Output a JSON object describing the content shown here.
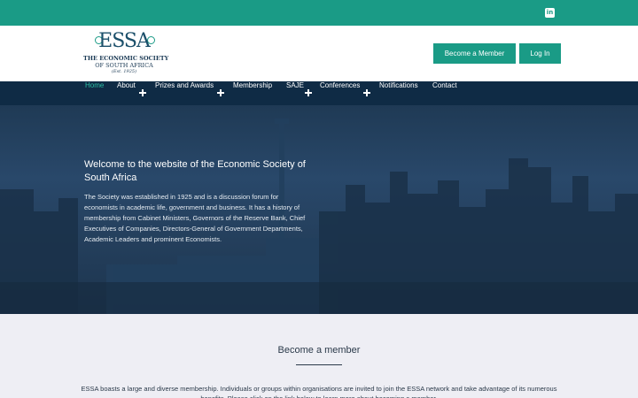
{
  "topbar": {
    "social_icon": "linkedin-icon",
    "social_glyph": "in"
  },
  "logo": {
    "mark": "ESSA",
    "line1": "THE ECONOMIC SOCIETY",
    "line2": "OF SOUTH AFRICA",
    "line3": "(Est. 1925)"
  },
  "header": {
    "become_member_label": "Become a Member",
    "login_label": "Log In"
  },
  "nav": {
    "items": [
      {
        "label": "Home",
        "active": true,
        "has_submenu": false
      },
      {
        "label": "About",
        "active": false,
        "has_submenu": true
      },
      {
        "label": "Prizes and Awards",
        "active": false,
        "has_submenu": true
      },
      {
        "label": "Membership",
        "active": false,
        "has_submenu": false
      },
      {
        "label": "SAJE",
        "active": false,
        "has_submenu": true
      },
      {
        "label": "Conferences",
        "active": false,
        "has_submenu": true
      },
      {
        "label": "Notifications",
        "active": false,
        "has_submenu": false
      },
      {
        "label": "Contact",
        "active": false,
        "has_submenu": false
      }
    ],
    "active_color": "#2bbfa4"
  },
  "hero": {
    "title": "Welcome to the website of the Economic Society of South Africa",
    "text": "The Society was established in 1925 and is a discussion forum for economists in academic life, government and business. It has a history of membership from Cabinet Ministers, Governors of the Reserve Bank, Chief Executives of Companies, Directors-General of Government Departments, Academic Leaders and prominent Economists."
  },
  "member_section": {
    "title": "Become a member",
    "text": "ESSA boasts a large and diverse membership. Individuals or groups within organisations are invited to join the ESSA network and take advantage of its numerous benefits. Please click on the link below to learn more about becoming a member."
  },
  "colors": {
    "brand_teal": "#1a9b86",
    "nav_bg": "#0f2b45",
    "section_bg": "#eeeef4"
  }
}
